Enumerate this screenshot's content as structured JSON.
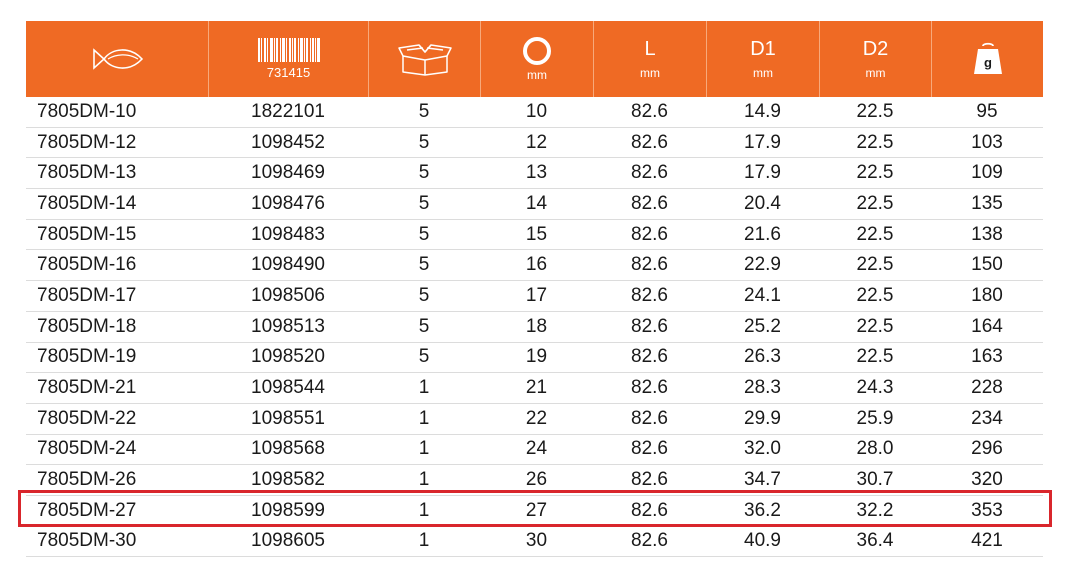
{
  "header": {
    "barcode_number": "731415",
    "col_bore_unit": "mm",
    "col_L_label": "L",
    "col_L_unit": "mm",
    "col_D1_label": "D1",
    "col_D1_unit": "mm",
    "col_D2_label": "D2",
    "col_D2_unit": "mm",
    "weight_symbol": "g",
    "colors": {
      "header_bg": "#ef6a24",
      "highlight": "#d9262c"
    }
  },
  "rows": [
    [
      "7805DM-10",
      "1822101",
      "5",
      "10",
      "82.6",
      "14.9",
      "22.5",
      "95"
    ],
    [
      "7805DM-12",
      "1098452",
      "5",
      "12",
      "82.6",
      "17.9",
      "22.5",
      "103"
    ],
    [
      "7805DM-13",
      "1098469",
      "5",
      "13",
      "82.6",
      "17.9",
      "22.5",
      "109"
    ],
    [
      "7805DM-14",
      "1098476",
      "5",
      "14",
      "82.6",
      "20.4",
      "22.5",
      "135"
    ],
    [
      "7805DM-15",
      "1098483",
      "5",
      "15",
      "82.6",
      "21.6",
      "22.5",
      "138"
    ],
    [
      "7805DM-16",
      "1098490",
      "5",
      "16",
      "82.6",
      "22.9",
      "22.5",
      "150"
    ],
    [
      "7805DM-17",
      "1098506",
      "5",
      "17",
      "82.6",
      "24.1",
      "22.5",
      "180"
    ],
    [
      "7805DM-18",
      "1098513",
      "5",
      "18",
      "82.6",
      "25.2",
      "22.5",
      "164"
    ],
    [
      "7805DM-19",
      "1098520",
      "5",
      "19",
      "82.6",
      "26.3",
      "22.5",
      "163"
    ],
    [
      "7805DM-21",
      "1098544",
      "1",
      "21",
      "82.6",
      "28.3",
      "24.3",
      "228"
    ],
    [
      "7805DM-22",
      "1098551",
      "1",
      "22",
      "82.6",
      "29.9",
      "25.9",
      "234"
    ],
    [
      "7805DM-24",
      "1098568",
      "1",
      "24",
      "82.6",
      "32.0",
      "28.0",
      "296"
    ],
    [
      "7805DM-26",
      "1098582",
      "1",
      "26",
      "82.6",
      "34.7",
      "30.7",
      "320"
    ],
    [
      "7805DM-27",
      "1098599",
      "1",
      "27",
      "82.6",
      "36.2",
      "32.2",
      "353"
    ],
    [
      "7805DM-30",
      "1098605",
      "1",
      "30",
      "82.6",
      "40.9",
      "36.4",
      "421"
    ]
  ]
}
